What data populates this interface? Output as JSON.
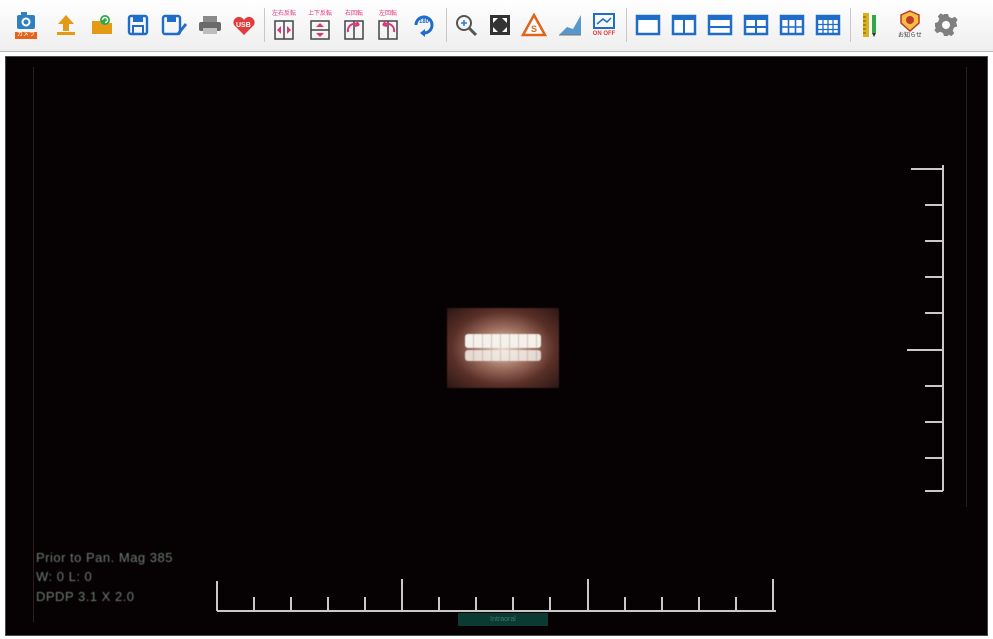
{
  "toolbar": {
    "buttons": [
      {
        "name": "camera",
        "caption": "カメラ",
        "color": "#2f7fc1"
      },
      {
        "name": "import",
        "caption": "",
        "color": "#e49a15"
      },
      {
        "name": "capture-import",
        "caption": "",
        "color": "#e49a15"
      },
      {
        "name": "save",
        "caption": "",
        "color": "#1f6cc9"
      },
      {
        "name": "save-as",
        "caption": "",
        "color": "#1f6cc9"
      },
      {
        "name": "print",
        "caption": "",
        "color": "#6a6a6a"
      },
      {
        "name": "usb",
        "caption": "USB",
        "color": "#e23b3b"
      },
      {
        "name": "flip-horizontal",
        "caption": "左右反転",
        "color": "#e4327a"
      },
      {
        "name": "flip-vertical",
        "caption": "上下反転",
        "color": "#e4327a"
      },
      {
        "name": "rotate-right",
        "caption": "右回転",
        "color": "#e4327a"
      },
      {
        "name": "rotate-left",
        "caption": "左回転",
        "color": "#e4327a"
      },
      {
        "name": "rotate-180",
        "caption": "180°",
        "color": "#1f6cc9"
      },
      {
        "name": "zoom",
        "caption": "",
        "color": "#2f7fc1"
      },
      {
        "name": "fit",
        "caption": "",
        "color": "#333333"
      },
      {
        "name": "sharpen",
        "caption": "S",
        "color": "#e0641c"
      },
      {
        "name": "contrast",
        "caption": "",
        "color": "#2f7fc1"
      },
      {
        "name": "overlay-toggle",
        "caption": "ON OFF",
        "color": "#1f6cc9"
      },
      {
        "name": "layout-1",
        "caption": "",
        "color": "#1f6cc9"
      },
      {
        "name": "layout-2",
        "caption": "",
        "color": "#1f6cc9"
      },
      {
        "name": "layout-3",
        "caption": "",
        "color": "#1f6cc9"
      },
      {
        "name": "layout-4",
        "caption": "",
        "color": "#1f6cc9"
      },
      {
        "name": "layout-6",
        "caption": "",
        "color": "#1f6cc9"
      },
      {
        "name": "layout-9",
        "caption": "",
        "color": "#1f6cc9"
      },
      {
        "name": "ruler",
        "caption": "",
        "color": "#d8b21a"
      },
      {
        "name": "info",
        "caption": "お知らせ",
        "color": "#c0392b"
      },
      {
        "name": "settings",
        "caption": "",
        "color": "#777777"
      }
    ]
  },
  "viewer": {
    "background": "#060103",
    "overlay": {
      "line1": "Prior to Pan. Mag 385",
      "line2": "W: 0 L: 0",
      "line3": "DPDP 3.1 X 2.0"
    },
    "scale_label": "Intraoral"
  }
}
